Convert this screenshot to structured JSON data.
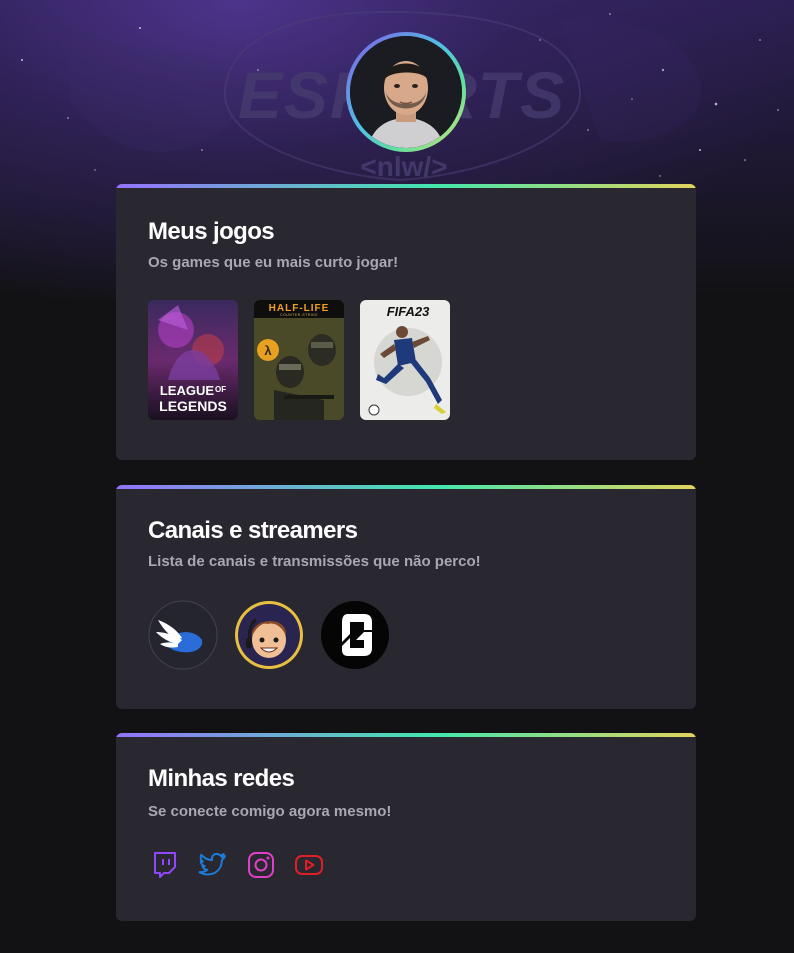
{
  "hero": {
    "background_text_top": "ESPORTS",
    "background_text_bottom": "<nlw/>"
  },
  "profile": {
    "avatar": "user-photo"
  },
  "games_section": {
    "title": "Meus jogos",
    "subtitle": "Os games que eu mais curto jogar!",
    "games": [
      {
        "title_line1": "LEAGUE",
        "title_of": "OF",
        "title_line2": "LEGENDS",
        "icon": "league-of-legends-cover"
      },
      {
        "title": "HALF-LIFE",
        "sub": "COUNTER-STRIKE",
        "icon": "counter-strike-cover"
      },
      {
        "title": "FIFA23",
        "icon": "fifa-23-cover"
      }
    ]
  },
  "channels_section": {
    "title": "Canais e streamers",
    "subtitle": "Lista de canais e transmissões que não perco!",
    "channels": [
      {
        "icon": "winged-helmet-channel-logo"
      },
      {
        "icon": "streamer-cartoon-avatar"
      },
      {
        "icon": "rainbow-six-logo"
      }
    ]
  },
  "social_section": {
    "title": "Minhas redes",
    "subtitle": "Se conecte comigo agora mesmo!",
    "networks": [
      {
        "name": "twitch",
        "icon": "twitch-icon",
        "color": "#9146ff"
      },
      {
        "name": "twitter",
        "icon": "twitter-icon",
        "color": "#1d7bd8"
      },
      {
        "name": "instagram",
        "icon": "instagram-icon",
        "color": "#e040c8"
      },
      {
        "name": "youtube",
        "icon": "youtube-icon",
        "color": "#e01e26"
      }
    ]
  },
  "colors": {
    "background": "#121214",
    "card": "#29272f",
    "accent_gradient": [
      "#9572fc",
      "#43e7ad",
      "#e2d45c"
    ],
    "subtitle_text": "#a8a8b3"
  }
}
